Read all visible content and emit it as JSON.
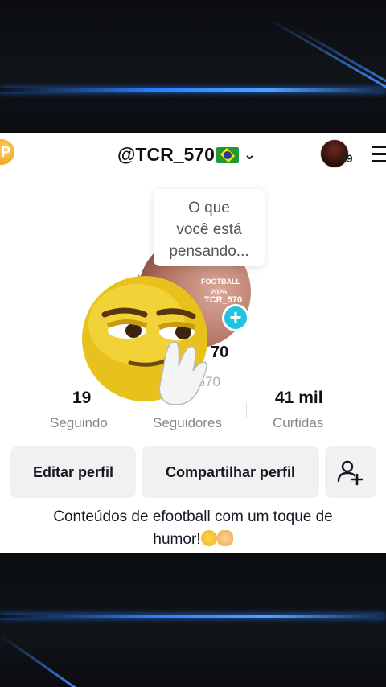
{
  "header": {
    "username": "@TCR_570",
    "avatar_badge": "99",
    "coin_glyph": "P"
  },
  "bubble": {
    "line1": "O que",
    "line2": "você está",
    "line3": "pensando..."
  },
  "profile": {
    "pic_text_1": "FOOTBALL",
    "pic_text_2": "2026",
    "pic_text_3": "TCR_570",
    "handle_partial": "70",
    "watermark": "@TCR_570"
  },
  "stats": [
    {
      "value": "19",
      "label": "Seguindo"
    },
    {
      "value": "",
      "label": "Seguidores"
    },
    {
      "value": "41 mil",
      "label": "Curtidas"
    }
  ],
  "actions": {
    "edit": "Editar perfil",
    "share": "Compartilhar perfil"
  },
  "bio": {
    "line1": "Conteúdos de efootball com um toque de",
    "line2": "humor!"
  },
  "colors": {
    "accent_plus": "#20c4e0",
    "button_bg": "#f1f1f2",
    "streak": "#2a7fff"
  }
}
